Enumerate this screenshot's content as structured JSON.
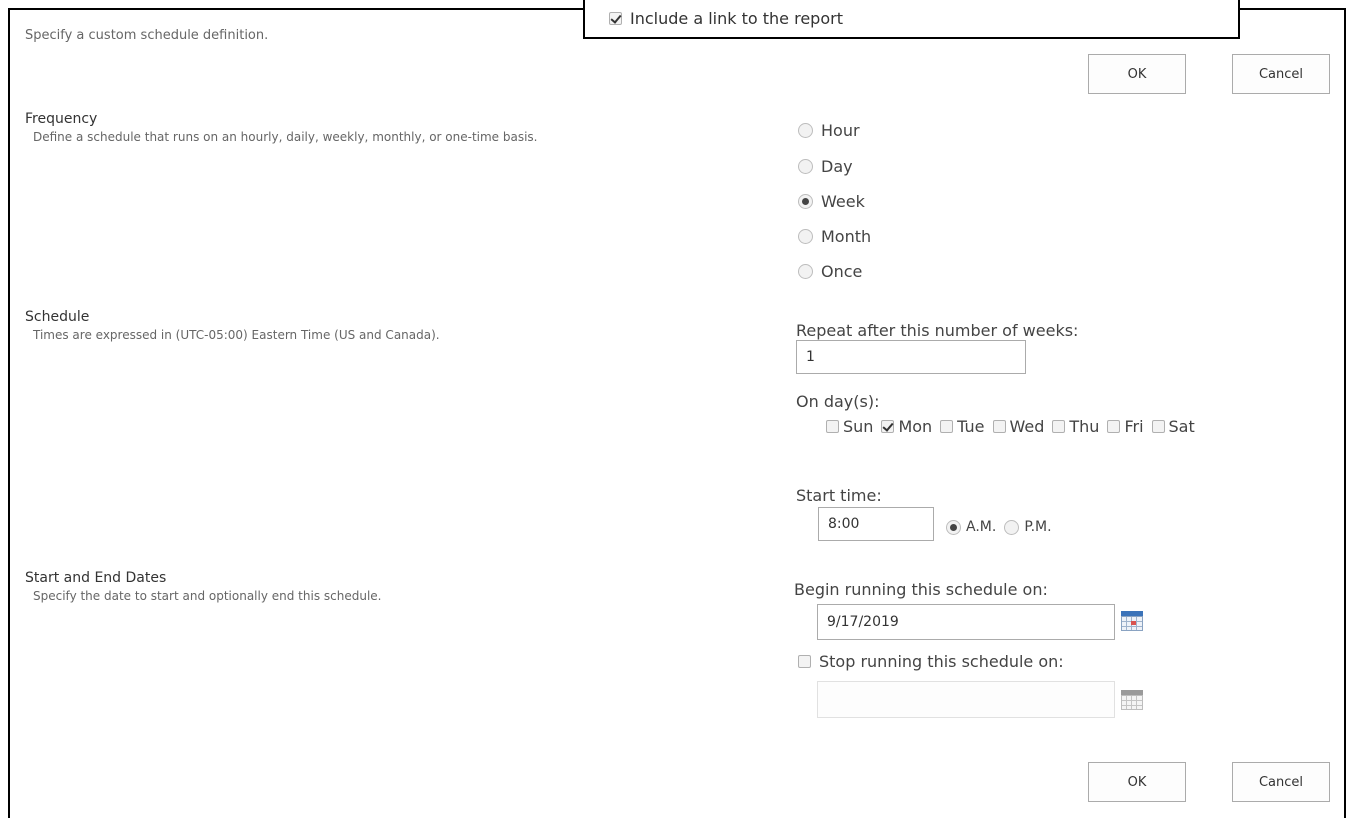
{
  "header": {
    "intro_text": "Specify a custom schedule definition.",
    "include_link_label": "Include a link to the report",
    "include_link_checked": true
  },
  "buttons": {
    "ok_label": "OK",
    "cancel_label": "Cancel"
  },
  "frequency": {
    "title": "Frequency",
    "description": "Define a schedule that runs on an hourly, daily, weekly, monthly, or one-time basis.",
    "options": [
      {
        "label": "Hour",
        "checked": false
      },
      {
        "label": "Day",
        "checked": false
      },
      {
        "label": "Week",
        "checked": true
      },
      {
        "label": "Month",
        "checked": false
      },
      {
        "label": "Once",
        "checked": false
      }
    ]
  },
  "schedule": {
    "title": "Schedule",
    "description": "Times are expressed in (UTC-05:00) Eastern Time (US and Canada).",
    "repeat_label": "Repeat after this number of weeks:",
    "repeat_value": "1",
    "days_label": "On day(s):",
    "days": [
      {
        "label": "Sun",
        "checked": false
      },
      {
        "label": "Mon",
        "checked": true
      },
      {
        "label": "Tue",
        "checked": false
      },
      {
        "label": "Wed",
        "checked": false
      },
      {
        "label": "Thu",
        "checked": false
      },
      {
        "label": "Fri",
        "checked": false
      },
      {
        "label": "Sat",
        "checked": false
      }
    ],
    "start_time_label": "Start time:",
    "start_time_value": "8:00",
    "am_label": "A.M.",
    "pm_label": "P.M.",
    "am_checked": true
  },
  "dates": {
    "title": "Start and End Dates",
    "description": "Specify the date to start and optionally end this schedule.",
    "begin_label": "Begin running this schedule on:",
    "begin_value": "9/17/2019",
    "stop_label": "Stop running this schedule on:",
    "stop_checked": false,
    "stop_value": ""
  },
  "icons": {
    "calendar": "calendar-icon"
  }
}
